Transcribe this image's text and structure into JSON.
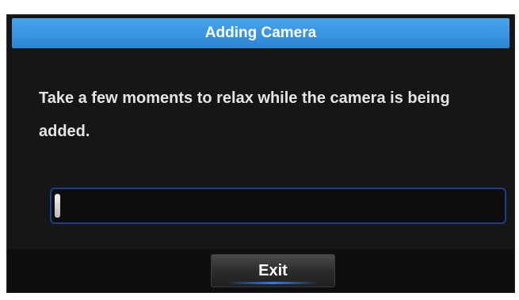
{
  "dialog": {
    "title": "Adding Camera",
    "message": "Take a few moments to relax while the camera is being added.",
    "progress": 0.01,
    "exit_label": "Exit"
  },
  "colors": {
    "title_bar": "#2a86d6",
    "background": "#151515",
    "progress_border": "#1b3f8a",
    "button_accent": "#2f7bf0"
  }
}
